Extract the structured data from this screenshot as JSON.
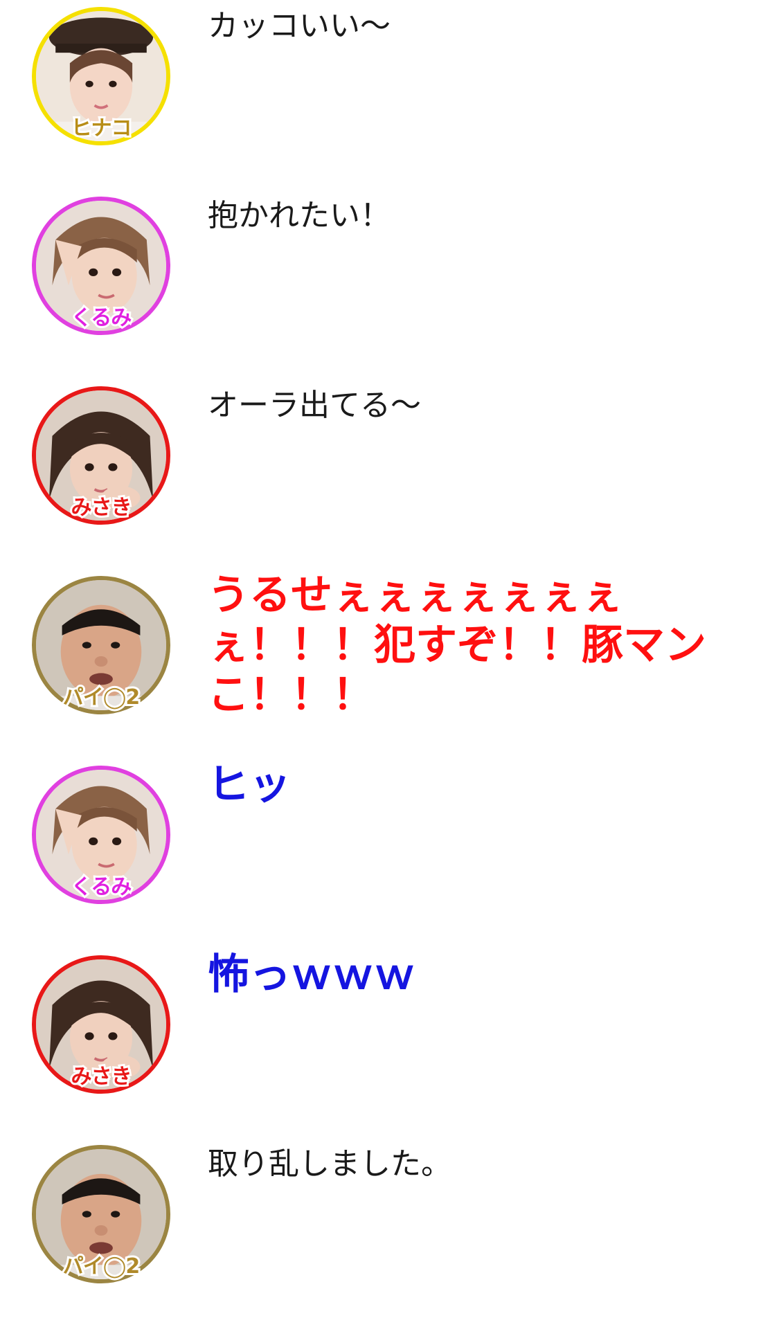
{
  "colors": {
    "hinako": "#f5e000",
    "kurumi": "#e040e0",
    "misaki": "#e81818",
    "paio2": "#9b8542",
    "red_text": "#ff1010",
    "blue_text": "#1515e0",
    "normal_text": "#1a1a1a"
  },
  "messages": [
    {
      "speaker": "ヒナコ",
      "avatar": "hinako-avatar-icon",
      "text": "カッコいい〜",
      "style": "normal"
    },
    {
      "speaker": "くるみ",
      "avatar": "kurumi-avatar-icon",
      "text": "抱かれたい！",
      "style": "normal"
    },
    {
      "speaker": "みさき",
      "avatar": "misaki-avatar-icon",
      "text": "オーラ出てる〜",
      "style": "normal"
    },
    {
      "speaker": "パイ◯2",
      "avatar": "paio2-avatar-icon",
      "text": "うるせぇぇぇぇぇぇぇぇ！！！犯すぞ！！豚マンこ！！！",
      "style": "shout-red"
    },
    {
      "speaker": "くるみ",
      "avatar": "kurumi-avatar-icon",
      "text": "ヒッ",
      "style": "shout-blue"
    },
    {
      "speaker": "みさき",
      "avatar": "misaki-avatar-icon",
      "text": "怖っｗｗｗ",
      "style": "shout-blue"
    },
    {
      "speaker": "パイ◯2",
      "avatar": "paio2-avatar-icon",
      "text": "取り乱しました。",
      "style": "normal"
    }
  ]
}
